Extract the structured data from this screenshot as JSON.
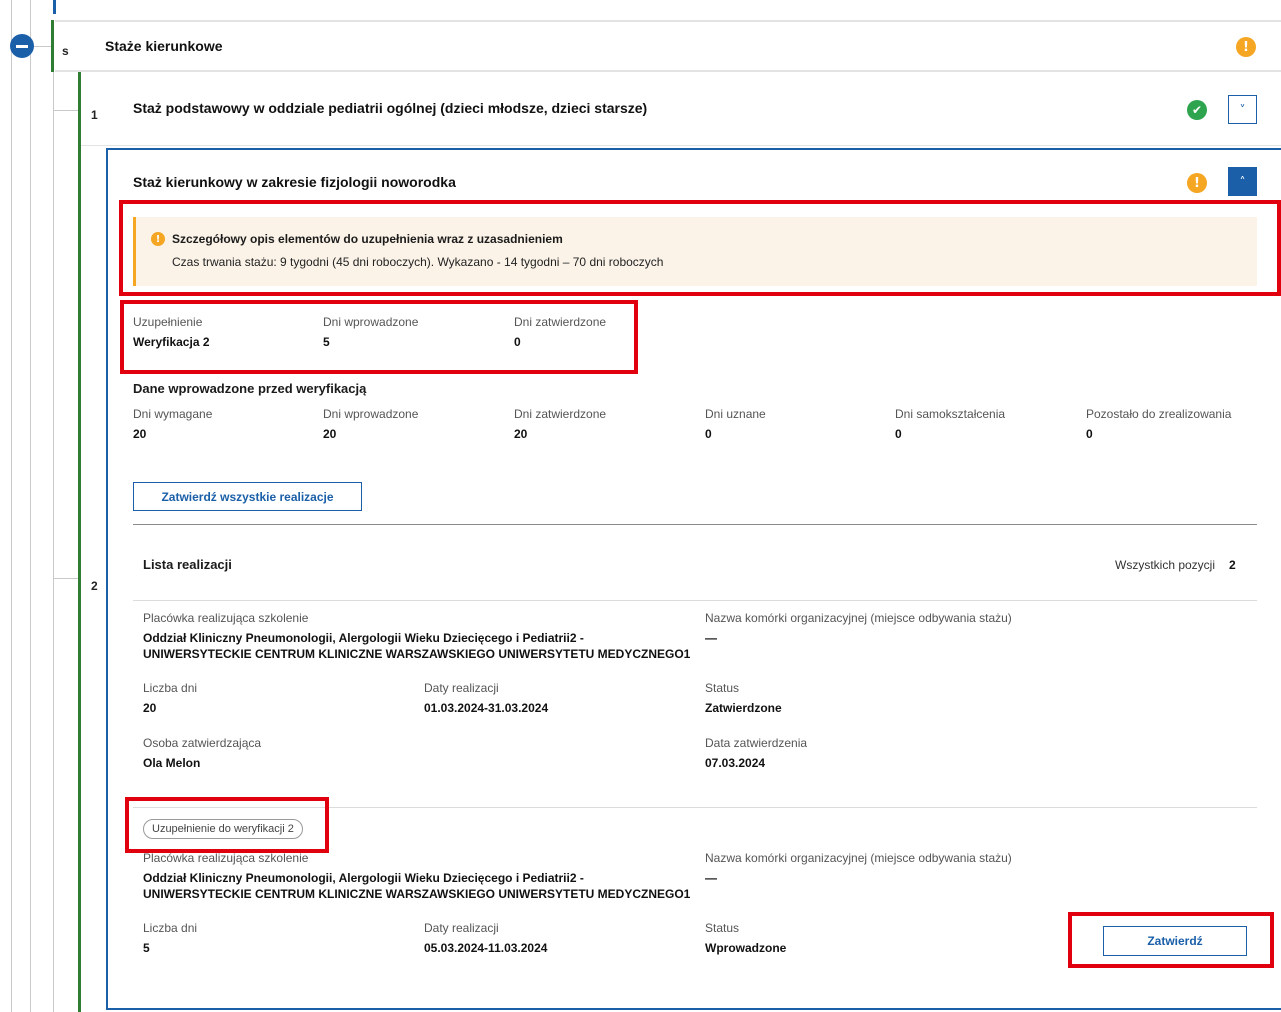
{
  "section_s": {
    "badge": "s",
    "title": "Staże kierunkowe",
    "toggle_icon": "minus-circle-icon",
    "status_icon": "warning-icon"
  },
  "item1": {
    "number": "1",
    "title": "Staż podstawowy w oddziale pediatrii ogólnej (dzieci młodsze, dzieci starsze)",
    "status_icon": "check-icon",
    "chevron": "˅"
  },
  "item2": {
    "number": "2",
    "title": "Staż kierunkowy w zakresie fizjologii noworodka",
    "status_icon": "warning-icon",
    "chevron": "˄",
    "alert": {
      "title": "Szczegółowy opis elementów do uzupełnienia wraz z uzasadnieniem",
      "text": "Czas trwania stażu: 9 tygodni (45 dni roboczych). Wykazano - 14 tygodni – 70 dni roboczych"
    },
    "supplement": {
      "label": "Uzupełnienie",
      "value": "Weryfikacja 2",
      "days_entered_label": "Dni wprowadzone",
      "days_entered": "5",
      "days_approved_label": "Dni zatwierdzone",
      "days_approved": "0"
    },
    "pre_verification": {
      "heading": "Dane wprowadzone przed weryfikacją",
      "fields": [
        {
          "label": "Dni wymagane",
          "value": "20"
        },
        {
          "label": "Dni wprowadzone",
          "value": "20"
        },
        {
          "label": "Dni zatwierdzone",
          "value": "20"
        },
        {
          "label": "Dni uznane",
          "value": "0"
        },
        {
          "label": "Dni samokształcenia",
          "value": "0"
        },
        {
          "label": "Pozostało do zrealizowania",
          "value": "0"
        }
      ]
    },
    "approve_all_label": "Zatwierdź wszystkie realizacje",
    "list": {
      "heading": "Lista realizacji",
      "total_label": "Wszystkich pozycji",
      "total": "2",
      "entries": [
        {
          "facility_label": "Placówka realizująca szkolenie",
          "facility_line1": "Oddział Kliniczny Pneumonologii, Alergologii Wieku Dziecięcego i Pediatrii2 -",
          "facility_line2": "UNIWERSYTECKIE CENTRUM KLINICZNE WARSZAWSKIEGO UNIWERSYTETU MEDYCZNEGO1",
          "unit_label": "Nazwa komórki organizacyjnej (miejsce odbywania stażu)",
          "unit_value": "—",
          "days_label": "Liczba dni",
          "days": "20",
          "dates_label": "Daty realizacji",
          "dates": "01.03.2024-31.03.2024",
          "status_label": "Status",
          "status": "Zatwierdzone",
          "approver_label": "Osoba zatwierdzająca",
          "approver": "Ola Melon",
          "approval_date_label": "Data zatwierdzenia",
          "approval_date": "07.03.2024"
        },
        {
          "tag": "Uzupełnienie do weryfikacji 2",
          "facility_label": "Placówka realizująca szkolenie",
          "facility_line1": "Oddział Kliniczny Pneumonologii, Alergologii Wieku Dziecięcego i Pediatrii2 -",
          "facility_line2": "UNIWERSYTECKIE CENTRUM KLINICZNE WARSZAWSKIEGO UNIWERSYTETU MEDYCZNEGO1",
          "unit_label": "Nazwa komórki organizacyjnej (miejsce odbywania stażu)",
          "unit_value": "—",
          "days_label": "Liczba dni",
          "days": "5",
          "dates_label": "Daty realizacji",
          "dates": "05.03.2024-11.03.2024",
          "status_label": "Status",
          "status": "Wprowadzone",
          "approve_label": "Zatwierdź"
        }
      ]
    }
  },
  "colors": {
    "accent": "#1a5fa8",
    "success": "#2ea44f",
    "warning": "#f5a623",
    "tree_green": "#2e7d32",
    "highlight": "#e0000e"
  }
}
